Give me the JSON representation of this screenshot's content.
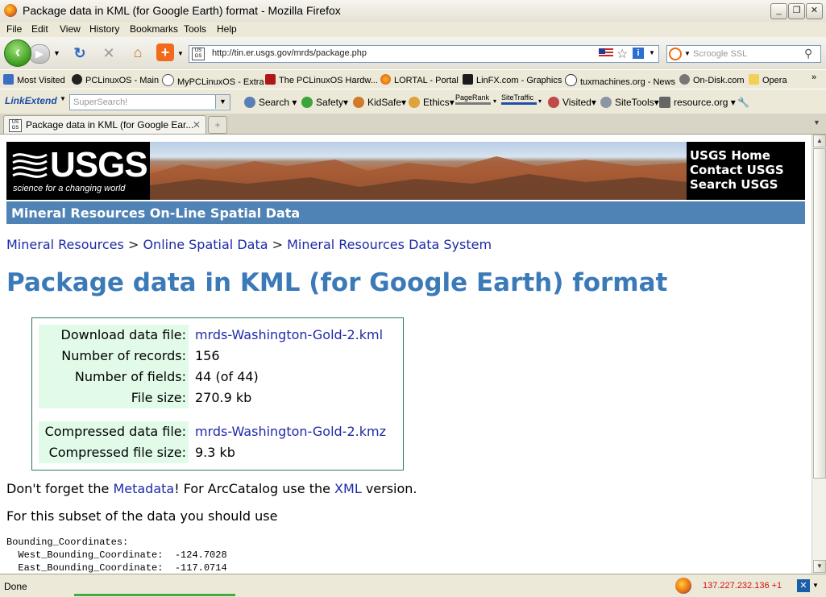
{
  "window": {
    "title": "Package data in KML (for Google Earth) format - Mozilla Firefox"
  },
  "menu": [
    "File",
    "Edit",
    "View",
    "History",
    "Bookmarks",
    "Tools",
    "Help"
  ],
  "nav": {
    "url": "http://tin.er.usgs.gov/mrds/package.php",
    "search_placeholder": "Scroogle SSL"
  },
  "bookmarks": [
    "Most Visited",
    "PCLinuxOS - Main",
    "MyPCLinuxOS - Extra",
    "The PCLinuxOS Hardw...",
    "LORTAL - Portal",
    "LinFX.com - Graphics",
    "tuxmachines.org - News",
    "On-Disk.com",
    "Opera"
  ],
  "linkextend": {
    "brand": "LinkExtend",
    "supersearch": "SuperSearch!",
    "items": [
      "Search",
      "Safety",
      "KidSafe",
      "Ethics",
      "PageRank",
      "SiteTraffic",
      "Visited",
      "SiteTools",
      "resource.org"
    ]
  },
  "tab": {
    "label": "Package data in KML (for Google Ear..."
  },
  "banner": {
    "logo": "USGS",
    "tagline": "science for a changing world",
    "links": [
      "USGS Home",
      "Contact USGS",
      "Search USGS"
    ],
    "subheader": "Mineral Resources On-Line Spatial Data"
  },
  "breadcrumb": [
    {
      "text": "Mineral Resources"
    },
    {
      "text": "Online Spatial Data"
    },
    {
      "text": "Mineral Resources Data System"
    }
  ],
  "breadcrumb_sep": ">",
  "page": {
    "title": "Package data in KML (for Google Earth) format",
    "rows": [
      {
        "label": "Download data file:",
        "value": "mrds-Washington-Gold-2.kml"
      },
      {
        "label": "Number of records:",
        "value": "156"
      },
      {
        "label": "Number of fields:",
        "value": "44 (of 44)"
      },
      {
        "label": "File size:",
        "value": "270.9 kb"
      },
      {
        "label": "Compressed data file:",
        "value": "mrds-Washington-Gold-2.kmz"
      },
      {
        "label": "Compressed file size:",
        "value": "9.3 kb"
      }
    ],
    "p1_a": "Don't forget the ",
    "p1_link1": "Metadata",
    "p1_b": "! For ArcCatalog use the ",
    "p1_link2": "XML",
    "p1_c": " version.",
    "p2": "For this subset of the data you should use",
    "code": [
      "Bounding_Coordinates:",
      "  West_Bounding_Coordinate:  -124.7028",
      "  East_Bounding_Coordinate:  -117.0714"
    ]
  },
  "status": {
    "text": "Done",
    "ip": "137.227.232.136 +1"
  }
}
